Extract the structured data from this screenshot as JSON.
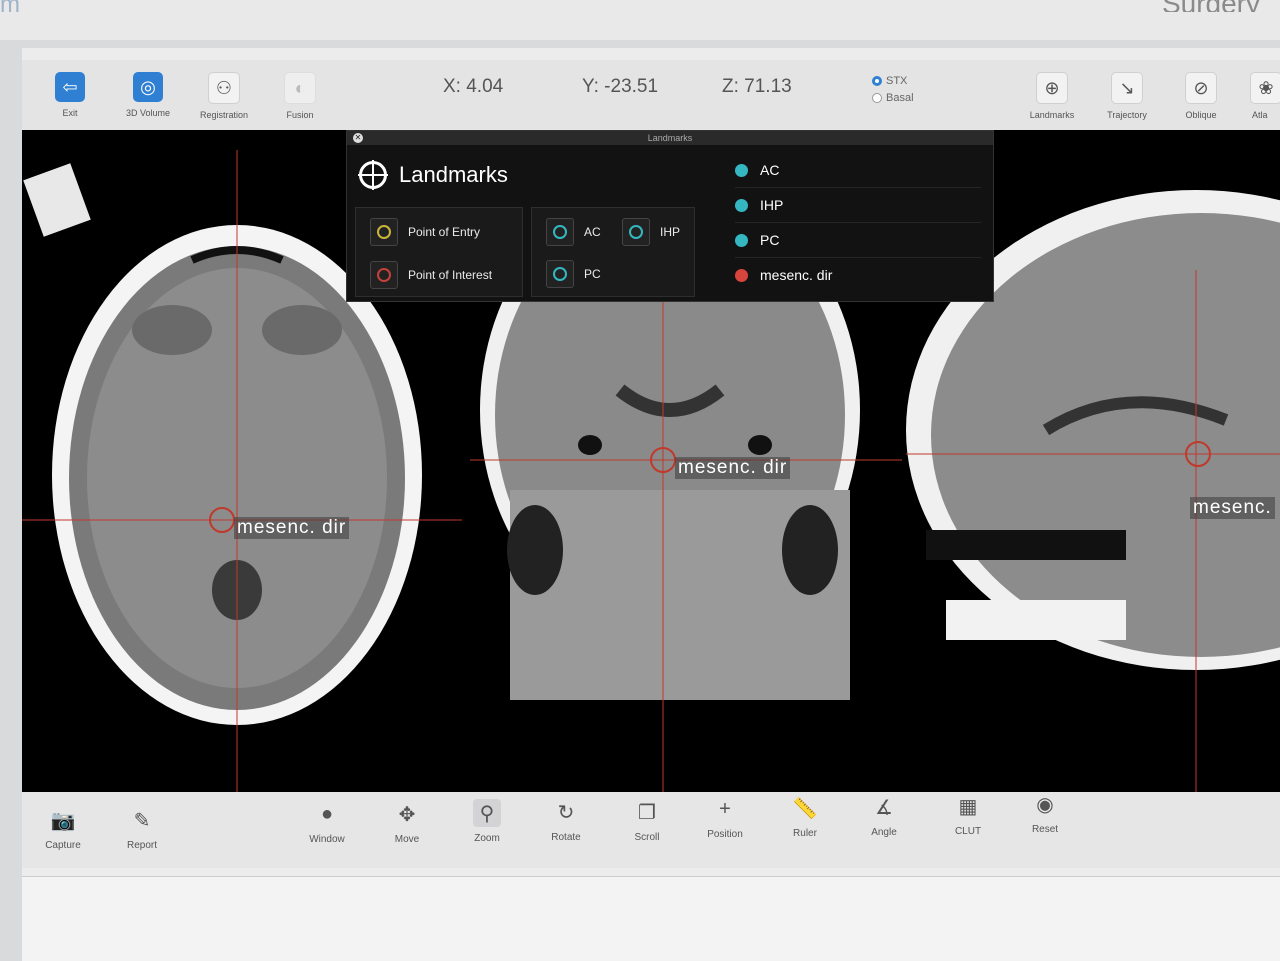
{
  "toolbar": {
    "left_buttons": [
      {
        "label": "Exit",
        "icon": "exit-icon"
      },
      {
        "label": "3D Volume",
        "icon": "3d-volume-icon"
      },
      {
        "label": "Registration",
        "icon": "registration-icon"
      },
      {
        "label": "Fusion",
        "icon": "fusion-icon"
      }
    ],
    "coords": {
      "x": "X: 4.04",
      "y": "Y: -23.51",
      "z": "Z: 71.13"
    },
    "space_options": [
      {
        "label": "STX",
        "selected": true
      },
      {
        "label": "Basal",
        "selected": false
      }
    ],
    "right_buttons": [
      {
        "label": "Landmarks",
        "icon": "landmarks-icon"
      },
      {
        "label": "Trajectory",
        "icon": "trajectory-icon"
      },
      {
        "label": "Oblique",
        "icon": "oblique-icon"
      },
      {
        "label": "Atla",
        "icon": "atlas-icon"
      }
    ]
  },
  "popup": {
    "window_title": "Landmarks",
    "heading": "Landmarks",
    "entry_group": [
      {
        "label": "Point of Entry",
        "color": "#c8b63a"
      },
      {
        "label": "Point of Interest",
        "color": "#c6413a"
      }
    ],
    "landmark_group": [
      {
        "label": "AC"
      },
      {
        "label": "IHP"
      },
      {
        "label": "PC"
      }
    ],
    "list": [
      {
        "label": "AC",
        "color": "#35b7c2"
      },
      {
        "label": "IHP",
        "color": "#35b7c2"
      },
      {
        "label": "PC",
        "color": "#35b7c2"
      },
      {
        "label": "mesenc. dir",
        "color": "#d6453d"
      }
    ]
  },
  "views": {
    "axial_label": "mesenc. dir",
    "coronal_label": "mesenc. dir",
    "sagittal_label": "mesenc."
  },
  "bottom_toolbar": [
    {
      "label": "Capture",
      "icon": "camera-icon"
    },
    {
      "label": "Report",
      "icon": "report-icon"
    },
    {
      "label": "Window",
      "icon": "window-icon"
    },
    {
      "label": "Move",
      "icon": "move-icon"
    },
    {
      "label": "Zoom",
      "icon": "zoom-icon"
    },
    {
      "label": "Rotate",
      "icon": "rotate-icon"
    },
    {
      "label": "Scroll",
      "icon": "scroll-icon"
    },
    {
      "label": "Position",
      "icon": "position-icon"
    },
    {
      "label": "Ruler",
      "icon": "ruler-icon"
    },
    {
      "label": "Angle",
      "icon": "angle-icon"
    },
    {
      "label": "CLUT",
      "icon": "clut-icon"
    },
    {
      "label": "Reset",
      "icon": "reset-icon"
    }
  ]
}
